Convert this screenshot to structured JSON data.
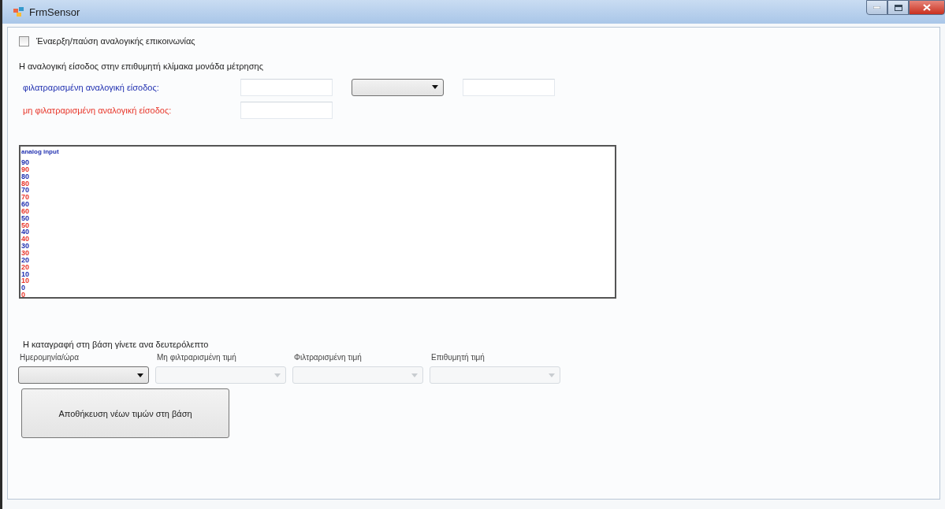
{
  "window": {
    "title": "FrmSensor"
  },
  "comm_checkbox": {
    "label": "Έναερξη/παύση αναλογικής επικοινωνίας",
    "checked": false
  },
  "scale_heading": "Η αναλογική είσοδος στην επιθυμητή κλίμακα μονάδα μέτρησης",
  "inputs": [
    {
      "label": "φιλατραρισμένη αναλογική είσοδος:",
      "color": "#2030b0",
      "fields": [
        {
          "kind": "textbox"
        },
        {
          "kind": "combo"
        },
        {
          "kind": "textbox"
        }
      ]
    },
    {
      "label": "μη φιλατραρισμένη αναλογική είσοδος:",
      "color": "#e8362a",
      "fields": [
        {
          "kind": "textbox"
        }
      ]
    }
  ],
  "plot": {
    "title": "analog input",
    "axes": [
      {
        "color": "#2030b0",
        "ticks": [
          "90",
          "80",
          "70",
          "60",
          "50",
          "40",
          "30",
          "20",
          "10",
          "0"
        ]
      },
      {
        "color": "#e8362a",
        "ticks": [
          "90",
          "80",
          "70",
          "60",
          "50",
          "40",
          "30",
          "20",
          "10",
          "0"
        ]
      }
    ]
  },
  "log_heading": "Η καταγραφή στη βάση γίνετε ανα δευτερόλεπτο",
  "log_fields": [
    {
      "label": "Ημερομηνία/ώρα",
      "disabled": false
    },
    {
      "label": "Μη φιλτραρισμένη τιμή",
      "disabled": true
    },
    {
      "label": "Φιλτραρισμένη τιμή",
      "disabled": true
    },
    {
      "label": "Επιθυμητή τιμή",
      "disabled": true
    }
  ],
  "save_button": "Αποθήκευση νέων τιμών στη βάση"
}
